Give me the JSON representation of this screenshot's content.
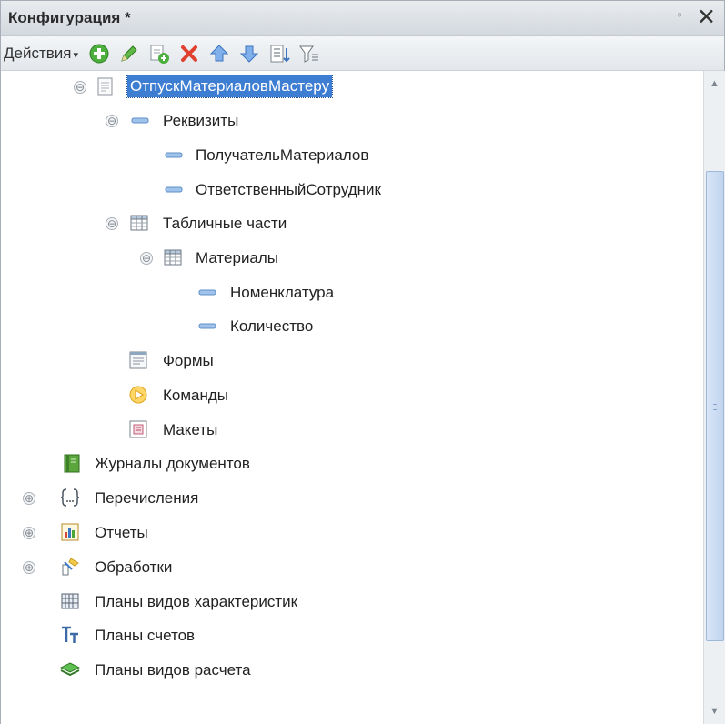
{
  "panel": {
    "title": "Конфигурация *",
    "pin_glyph": "ᵒ",
    "close_glyph": "✕"
  },
  "toolbar": {
    "actions_label": "Действия",
    "caret": "▾",
    "icons": [
      "add-icon",
      "edit-pencil-icon",
      "copy-add-icon",
      "delete-x-icon",
      "move-up-icon",
      "move-down-icon",
      "sort-icon",
      "filter-icon"
    ]
  },
  "tree": {
    "items": [
      {
        "label": "ОтпускМатериаловМастеру",
        "expander": "⊖",
        "icon": "document-icon",
        "selected": true
      },
      {
        "label": "Реквизиты",
        "expander": "⊖",
        "icon": "attribute-icon"
      },
      {
        "label": "ПолучательМатериалов",
        "icon": "attribute-icon"
      },
      {
        "label": "ОтветственныйСотрудник",
        "icon": "attribute-icon"
      },
      {
        "label": "Табличные части",
        "expander": "⊖",
        "icon": "table-icon"
      },
      {
        "label": "Материалы",
        "expander": "⊖",
        "icon": "table-icon"
      },
      {
        "label": "Номенклатура",
        "icon": "attribute-icon"
      },
      {
        "label": "Количество",
        "icon": "attribute-icon"
      },
      {
        "label": "Формы",
        "icon": "form-icon"
      },
      {
        "label": "Команды",
        "icon": "command-icon"
      },
      {
        "label": "Макеты",
        "icon": "template-icon"
      },
      {
        "label": "Журналы документов",
        "icon": "journal-icon"
      },
      {
        "label": "Перечисления",
        "expander": "⊕",
        "icon": "enum-icon"
      },
      {
        "label": "Отчеты",
        "expander": "⊕",
        "icon": "report-icon"
      },
      {
        "label": "Обработки",
        "expander": "⊕",
        "icon": "processing-icon"
      },
      {
        "label": "Планы видов характеристик",
        "icon": "characteristic-plan-icon"
      },
      {
        "label": "Планы счетов",
        "icon": "chart-of-accounts-icon"
      },
      {
        "label": "Планы видов расчета",
        "icon": "calculation-plan-icon"
      }
    ]
  },
  "scrollbar": {
    "up_glyph": "▲",
    "down_glyph": "▼"
  },
  "colors": {
    "selection": "#3e7ed2",
    "titlebar": "#dfe3e7",
    "scroll_thumb": "#c9dbf2"
  }
}
